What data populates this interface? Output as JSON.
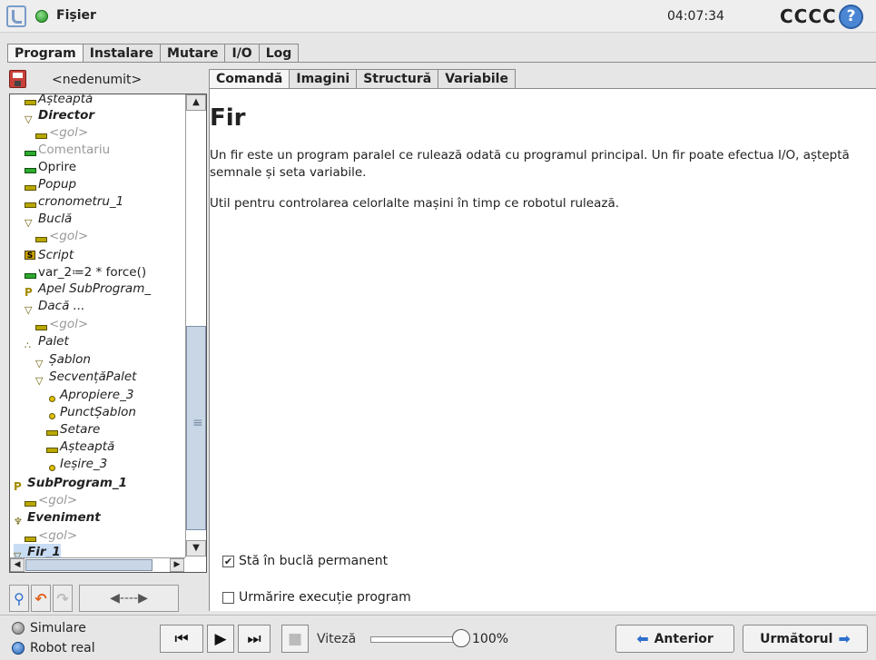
{
  "titlebar": {
    "file_label": "Fișier",
    "clock": "04:07:34",
    "robot_name": "CCCC",
    "help_glyph": "?"
  },
  "main_tabs": [
    "Program",
    "Instalare",
    "Mutare",
    "I/O",
    "Log"
  ],
  "program": {
    "name": "<nedenumit>"
  },
  "tree": [
    {
      "label": "Așteaptă",
      "icon": "wait-icon",
      "style": "it"
    },
    {
      "label": "Director",
      "icon": "folder-triangle-icon",
      "style": "it bold"
    },
    {
      "label": "<gol>",
      "icon": "wait-icon",
      "style": "it grey"
    },
    {
      "label": "Comentariu",
      "icon": "comment-icon",
      "style": "grey"
    },
    {
      "label": "Oprire",
      "icon": "comment-icon",
      "style": ""
    },
    {
      "label": "Popup",
      "icon": "wait-icon",
      "style": "it"
    },
    {
      "label": "cronometru_1",
      "icon": "wait-icon",
      "style": "it"
    },
    {
      "label": "Buclă",
      "icon": "loop-triangle-icon",
      "style": "it"
    },
    {
      "label": "<gol>",
      "icon": "wait-icon",
      "style": "it grey"
    },
    {
      "label": "Script",
      "icon": "script-icon",
      "style": "it"
    },
    {
      "label": "var_2≔2 * force()",
      "icon": "comment-icon",
      "style": ""
    },
    {
      "label": "Apel SubProgram_",
      "icon": "subprogram-icon",
      "style": "it"
    },
    {
      "label": "Dacă ...",
      "icon": "if-triangle-icon",
      "style": "it"
    },
    {
      "label": "<gol>",
      "icon": "wait-icon",
      "style": "it grey"
    },
    {
      "label": "Palet",
      "icon": "pallet-icon",
      "style": "it"
    },
    {
      "label": "Șablon",
      "icon": "pattern-triangle-icon",
      "style": "it"
    },
    {
      "label": "SecvențăPalet",
      "icon": "sequence-triangle-icon",
      "style": "it"
    },
    {
      "label": "Apropiere_3",
      "icon": "waypoint-icon",
      "style": "it"
    },
    {
      "label": "PunctȘablon",
      "icon": "waypoint-icon",
      "style": "it"
    },
    {
      "label": "Setare",
      "icon": "wait-icon",
      "style": "it"
    },
    {
      "label": "Așteaptă",
      "icon": "wait-icon",
      "style": "it"
    },
    {
      "label": "Ieșire_3",
      "icon": "waypoint-icon",
      "style": "it"
    },
    {
      "label": "SubProgram_1",
      "icon": "subprogram-icon",
      "style": "it bold"
    },
    {
      "label": "<gol>",
      "icon": "wait-icon",
      "style": "it grey"
    },
    {
      "label": "Eveniment",
      "icon": "event-icon",
      "style": "it bold"
    },
    {
      "label": "<gol>",
      "icon": "wait-icon",
      "style": "it grey"
    },
    {
      "label": "Fir_1",
      "icon": "thread-triangle-icon",
      "style": "it bold"
    }
  ],
  "sub_tabs": [
    "Comandă",
    "Imagini",
    "Structură",
    "Variabile"
  ],
  "content": {
    "title": "Fir",
    "description": "Un fir este un program paralel ce rulează odată cu programul principal. Un fir poate efectua I/O, așteptă semnale și seta variabile.",
    "description_2": "Util pentru controlarea celorlalte mașini în timp ce robotul rulează.",
    "loop_label": "Stă în buclă permanent",
    "loop_checked": "✔",
    "track_label": "Urmărire execuție program"
  },
  "bottom": {
    "mode_sim": "Simulare",
    "mode_real": "Robot real",
    "speed_label": "Viteză",
    "speed_value": "100%",
    "speed_fraction": 1.0,
    "prev_label": "Anterior",
    "next_label": "Următorul"
  }
}
